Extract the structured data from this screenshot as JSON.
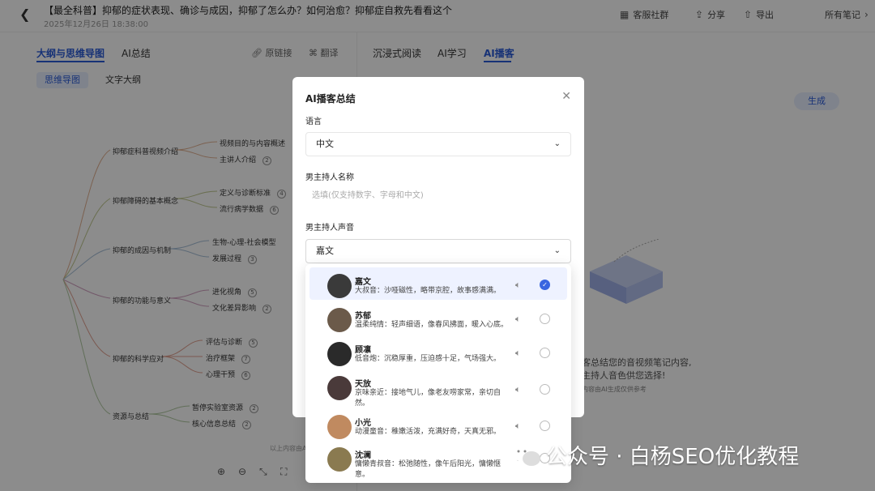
{
  "header": {
    "back_icon": "chevron-left-icon",
    "title": "【最全科普】抑郁的症状表现、确诊与成因，抑郁了怎么办？如何治愈？抑郁症自救先看看这个",
    "date": "2025年12月26日 18:38:00",
    "customer_group": "客服社群",
    "share": "分享",
    "export": "导出",
    "all_notes": "所有笔记"
  },
  "left_panel": {
    "tabs": [
      "大纲与思维导图",
      "AI总结"
    ],
    "source_link": "原链接",
    "translate": "翻译",
    "subtabs": [
      "思维导图",
      "文字大纲"
    ],
    "mindmap": {
      "branches": [
        {
          "label": "抑郁症科普视频介绍",
          "children": [
            {
              "label": "视频目的与内容概述",
              "n": ""
            },
            {
              "label": "主讲人介绍",
              "n": "2"
            }
          ]
        },
        {
          "label": "抑郁障碍的基本概念",
          "children": [
            {
              "label": "定义与诊断标准",
              "n": "4"
            },
            {
              "label": "流行病学数据",
              "n": "6"
            }
          ]
        },
        {
          "label": "抑郁的成因与机制",
          "children": [
            {
              "label": "生物-心理-社会模型",
              "n": ""
            },
            {
              "label": "发展过程",
              "n": "3"
            }
          ]
        },
        {
          "label": "抑郁的功能与意义",
          "children": [
            {
              "label": "进化视角",
              "n": "5"
            },
            {
              "label": "文化差异影响",
              "n": "2"
            }
          ]
        },
        {
          "label": "抑郁的科学应对",
          "children": [
            {
              "label": "评估与诊断",
              "n": "5"
            },
            {
              "label": "治疗框架",
              "n": "7"
            },
            {
              "label": "心理干预",
              "n": "6"
            }
          ]
        },
        {
          "label": "资源与总结",
          "children": [
            {
              "label": "暂停实验室资源",
              "n": "2"
            },
            {
              "label": "核心信息总结",
              "n": "2"
            }
          ]
        }
      ],
      "footer_note": "以上内容由AI"
    }
  },
  "right_panel": {
    "tabs": [
      "沉浸式阅读",
      "AI学习",
      "AI播客"
    ],
    "generate": "生成",
    "hint_line1": "客总结您的音视频笔记内容,",
    "hint_line2": "主持人音色供您选择!",
    "hint_small": "内容由AI生成仅供参考"
  },
  "modal": {
    "title": "AI播客总结",
    "language_label": "语言",
    "language_value": "中文",
    "host_name_label": "男主持人名称",
    "host_name_placeholder": "选填(仅支持数字、字母和中文)",
    "host_voice_label": "男主持人声音",
    "host_voice_value": "嘉文",
    "voices": [
      {
        "name": "嘉文",
        "desc": "大叔音：沙哑磁性，略带京腔，故事感满满。",
        "selected": true,
        "avatar_color": "#3a3a3a"
      },
      {
        "name": "苏郁",
        "desc": "温柔纯情：轻声细语，像春风拂面，暖入心底。",
        "selected": false,
        "avatar_color": "#6b5a4a"
      },
      {
        "name": "顾凛",
        "desc": "低音炮：沉稳厚重，压迫感十足，气场强大。",
        "selected": false,
        "avatar_color": "#2a2a2a"
      },
      {
        "name": "天放",
        "desc": "京味亲近：接地气儿，像老友唠家常，亲切自然。",
        "selected": false,
        "avatar_color": "#4a3a3a"
      },
      {
        "name": "小光",
        "desc": "动漫童音：稚嫩活泼，充满好奇，天真无邪。",
        "selected": false,
        "avatar_color": "#c08a60"
      },
      {
        "name": "沈澜",
        "desc": "慵懒青叔音：松弛随性，像午后阳光，慵懒惬意。",
        "selected": false,
        "avatar_color": "#8a7a50"
      }
    ]
  },
  "watermark": {
    "text": "公众号 · 白杨SEO优化教程"
  }
}
